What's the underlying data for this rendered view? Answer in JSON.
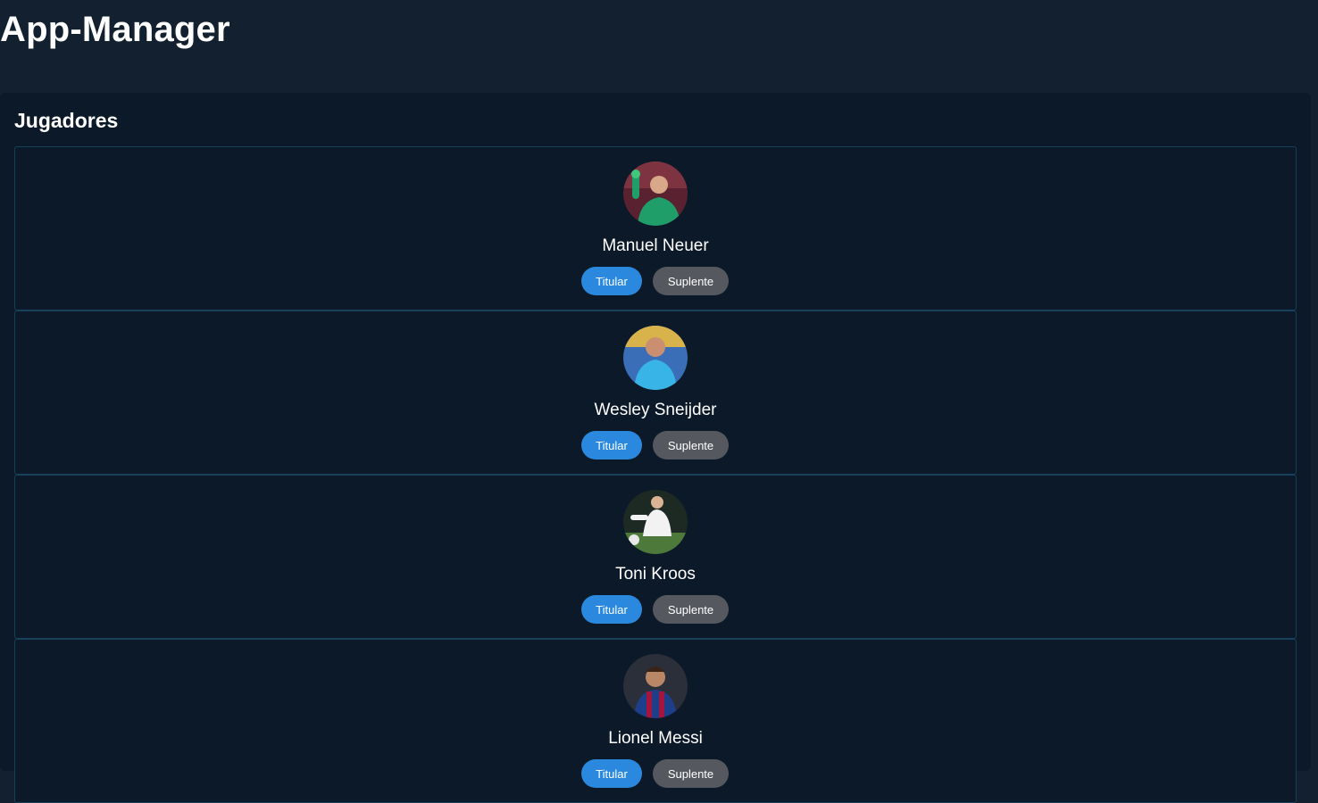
{
  "app": {
    "title": "App-Manager"
  },
  "players_section": {
    "title": "Jugadores",
    "players": [
      {
        "name": "Manuel Neuer",
        "titular_label": "Titular",
        "suplente_label": "Suplente"
      },
      {
        "name": "Wesley Sneijder",
        "titular_label": "Titular",
        "suplente_label": "Suplente"
      },
      {
        "name": "Toni Kroos",
        "titular_label": "Titular",
        "suplente_label": "Suplente"
      },
      {
        "name": "Lionel Messi",
        "titular_label": "Titular",
        "suplente_label": "Suplente"
      }
    ]
  },
  "colors": {
    "page_background": "#12202f",
    "panel_background": "#0c1928",
    "card_border": "#17415a",
    "titular_button": "#2a88de",
    "suplente_button": "#55595f"
  }
}
